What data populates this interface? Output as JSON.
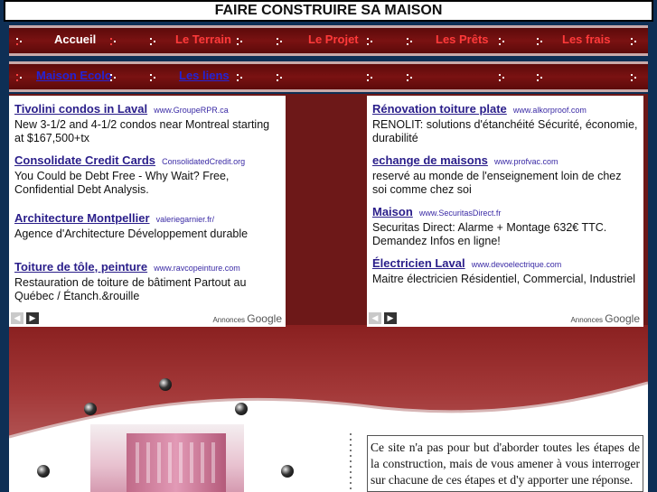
{
  "site": {
    "title": "FAIRE CONSTRUIRE SA MAISON"
  },
  "nav": {
    "row1": [
      {
        "label": "Accueil"
      },
      {
        "label": "Le Terrain"
      },
      {
        "label": "Le Projet"
      },
      {
        "label": "Les Prêts"
      },
      {
        "label": "Les frais"
      }
    ],
    "row2": [
      {
        "label": "Maison Ecolo"
      },
      {
        "label": "Les liens"
      }
    ]
  },
  "ads_left": [
    {
      "title": "Tivolini condos in Laval",
      "url": "www.GroupeRPR.ca",
      "desc": "New 3-1/2 and 4-1/2 condos near Montreal starting at $167,500+tx"
    },
    {
      "title": "Consolidate Credit Cards",
      "url": "ConsolidatedCredit.org",
      "desc": "You Could be Debt Free - Why Wait? Free, Confidential Debt Analysis."
    },
    {
      "title": "Architecture Montpellier",
      "url": "valeriegarnier.fr/",
      "desc": "Agence d'Architecture Développement durable"
    },
    {
      "title": "Toiture de tôle, peinture",
      "url": "www.ravcopeinture.com",
      "desc": "Restauration de toiture de bâtiment Partout au Québec / Étanch.&rouille"
    }
  ],
  "ads_right": [
    {
      "title": "Rénovation toiture plate",
      "url": "www.alkorproof.com",
      "desc": "RENOLIT: solutions d'étanchéité Sécurité, économie, durabilité"
    },
    {
      "title": "echange de maisons",
      "url": "www.profvac.com",
      "desc": "reservé au monde de l'enseignement loin de chez soi comme chez soi"
    },
    {
      "title": "Maison",
      "url": "www.SecuritasDirect.fr",
      "desc": "Securitas Direct: Alarme + Montage 632€ TTC. Demandez Infos en ligne!"
    },
    {
      "title": "Électricien Laval",
      "url": "www.devoelectrique.com",
      "desc": "Maitre électricien Résidentiel, Commercial, Industriel"
    }
  ],
  "ads_footer": {
    "annonces": "Annonces",
    "google": "Google",
    "prev_icon": "arrow-left-icon",
    "next_icon": "arrow-right-icon"
  },
  "intro": {
    "text": "Ce site n'a pas pour but d'aborder toutes les étapes de la construction, mais de vous amener à vous interroger sur chacune de ces étapes et d'y apporter une réponse."
  },
  "colors": {
    "background": "#0e2f55",
    "nav_red": "#ff3a3a",
    "content_red": "#6d1818",
    "ad_title": "#2a1e8a"
  }
}
